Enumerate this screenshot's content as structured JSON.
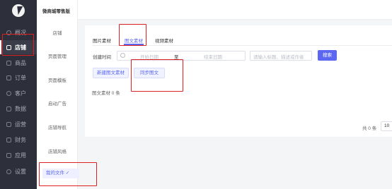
{
  "brand": {
    "logo": "lightning-logo"
  },
  "sidebar": {
    "items": [
      {
        "label": "概况",
        "icon": "circle-icon"
      },
      {
        "label": "店铺",
        "icon": "store-icon"
      },
      {
        "label": "商品",
        "icon": "box-icon"
      },
      {
        "label": "订单",
        "icon": "list-icon"
      },
      {
        "label": "客户",
        "icon": "user-icon"
      },
      {
        "label": "数据",
        "icon": "chart-icon"
      },
      {
        "label": "运营",
        "icon": "grid-icon"
      },
      {
        "label": "财务",
        "icon": "wallet-icon"
      },
      {
        "label": "应用",
        "icon": "apps-icon"
      },
      {
        "label": "设置",
        "icon": "gear-icon"
      }
    ],
    "active_index": 1
  },
  "subnav": {
    "shop_name": "微商城零售版",
    "items": [
      {
        "label": "店铺"
      },
      {
        "label": "页面管理"
      },
      {
        "label": "页面模板"
      },
      {
        "label": "启动广告"
      },
      {
        "label": "店铺导航"
      },
      {
        "label": "店铺风格"
      },
      {
        "label": "我的文件 ✓"
      }
    ]
  },
  "tabs": [
    {
      "label": "图片素材"
    },
    {
      "label": "图文素材"
    },
    {
      "label": "视频素材"
    }
  ],
  "filter": {
    "created_label": "创建时间",
    "start_placeholder": "开始日期",
    "to_label": "至",
    "end_placeholder": "结束日期",
    "search_placeholder": "请输入标题、描述或作者",
    "search_button": "搜索"
  },
  "actions": {
    "new_button": "新建图文素材",
    "sync_button": "同步图文"
  },
  "summary": {
    "count_text": "图文素材 0 条"
  },
  "pagination": {
    "total_text": "共 0 条",
    "page_size": "10"
  },
  "colors": {
    "sidebar_bg": "#2d2f3b",
    "accent": "#5b67f1",
    "highlight": "#e02020"
  }
}
